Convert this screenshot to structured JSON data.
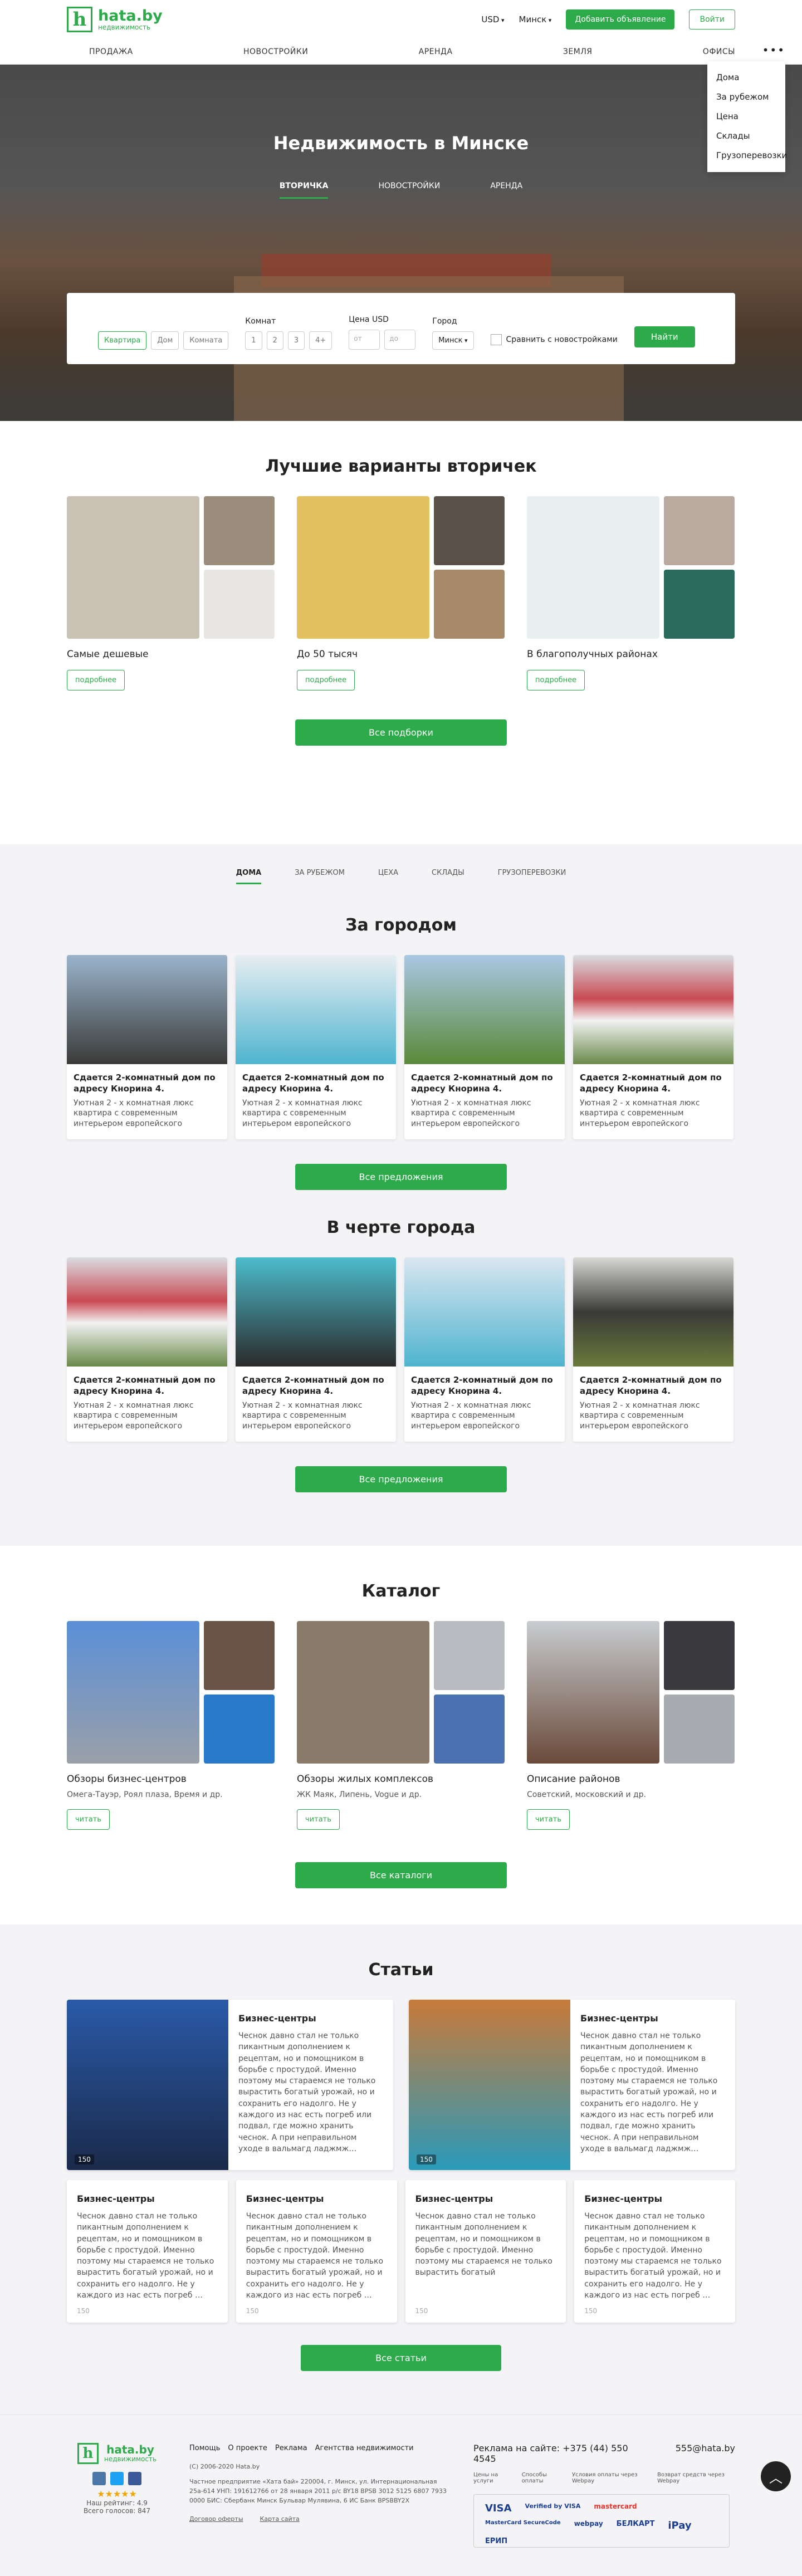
{
  "header": {
    "logo_letter": "h",
    "logo_title": "hata.by",
    "logo_sub": "недвижимость",
    "currency": "USD",
    "city": "Минск",
    "add_btn": "Добавить объявление",
    "login_btn": "Войти",
    "more": "•••"
  },
  "nav": [
    "ПРОДАЖА",
    "НОВОСТРОЙКИ",
    "АРЕНДА",
    "ЗЕМЛЯ",
    "ОФИСЫ"
  ],
  "dropdown": [
    "Дома",
    "За рубежом",
    "Цена",
    "Склады",
    "Грузоперевозки"
  ],
  "hero": {
    "title": "Недвижимость в Минске",
    "tabs": [
      "ВТОРИЧКА",
      "НОВОСТРОЙКИ",
      "АРЕНДА"
    ]
  },
  "search": {
    "types": [
      "Квартира",
      "Дом",
      "Комната"
    ],
    "rooms_label": "Комнат",
    "rooms": [
      "1",
      "2",
      "3",
      "4+"
    ],
    "price_label": "Цена USD",
    "from": "от",
    "to": "до",
    "city_label": "Город",
    "city": "Минск",
    "compare": "Сравнить с новостройками",
    "find": "Найти"
  },
  "best": {
    "title": "Лучшие варианты вторичек",
    "items": [
      {
        "caption": "Самые дешевые",
        "btn": "подробнее"
      },
      {
        "caption": "До 50 тысяч",
        "btn": "подробнее"
      },
      {
        "caption": "В благополучных районах",
        "btn": "подробнее"
      }
    ],
    "all_btn": "Все подборки"
  },
  "cats": [
    "ДОМА",
    "ЗА РУБЕЖОМ",
    "ЦЕХА",
    "СКЛАДЫ",
    "ГРУЗОПЕРЕВОЗКИ"
  ],
  "outside": {
    "title": "За городом",
    "btn": "Все предложения"
  },
  "city": {
    "title": "В черте города",
    "btn": "Все предложения"
  },
  "card": {
    "title": "Сдается 2-комнатный дом по адресу Кнорина 4.",
    "desc": "Уютная 2 - х комнатная люкс квартира с современным интерьером европейского"
  },
  "catalog": {
    "title": "Каталог",
    "items": [
      {
        "caption": "Обзоры бизнес-центров",
        "sub": "Омега-Тауэр, Роял плаза, Время и др.",
        "btn": "читать"
      },
      {
        "caption": "Обзоры жилых комплексов",
        "sub": "ЖК Маяк, Липень, Vogue и др.",
        "btn": "читать"
      },
      {
        "caption": "Описание районов",
        "sub": "Советский, московский и др.",
        "btn": "читать"
      }
    ],
    "all_btn": "Все каталоги"
  },
  "articles": {
    "title": "Статьи",
    "heading": "Бизнес-центры",
    "big_text": "Чеснок давно стал не только пикантным дополнением к рецептам, но и помощником в борьбе с простудой. Именно поэтому мы стараемся не только вырастить богатый урожай, но и сохранить его надолго. Не у каждого из нас есть погреб или подвал, где можно хранить чеснок. А при неправильном уходе в вальмагд ладжмж…",
    "sm_text": "Чеснок давно стал не только пикантным дополнением к рецептам, но и помощником в борьбе с простудой. Именно поэтому мы стараемся не только вырастить богатый урожай, но и сохранить его надолго. Не у каждого из нас есть погреб …",
    "sm_text_short": "Чеснок давно стал не только пикантным дополнением к рецептам, но и помощником в борьбе с простудой. Именно поэтому мы стараемся не только вырастить богатый",
    "views": "150",
    "all_btn": "Все статьи"
  },
  "footer": {
    "logo_title": "hata.by",
    "logo_sub": "недвижимость",
    "rating": "Наш рейтинг: 4.9",
    "votes": "Всего голосов: 847",
    "nav": [
      "Помощь",
      "О проекте",
      "Реклама",
      "Агентства недвижимости"
    ],
    "copy": "(С) 2006-2020 Hata.by",
    "legal": "Частное предприятие «Хата бай» 220004, г. Минск, ул. Интернациональная 25а-614 УНП: 191612766 от 28 января 2011 р/с BY18 BPSB 3012 5125 6807 7933 0000 БИС: Сбербанк Минск Бульвар Мулявина, 6 ИС Банк BPSBBY2X",
    "contract": "Договор оферты",
    "map": "Карта сайта",
    "ad_phone": "Реклама на сайте: +375 (44) 550 4545",
    "ad_mail": "555@hata.by",
    "pay_links": [
      "Цены на услуги",
      "Способы оплаты",
      "Условия оплаты через Webpay",
      "Возврат средств через Webpay"
    ],
    "pay": [
      "VISA",
      "Verified by VISA",
      "mastercard",
      "MasterCard SecureCode",
      "webpay",
      "БЕЛКАРТ",
      "iPay",
      "ЕРИП"
    ]
  }
}
